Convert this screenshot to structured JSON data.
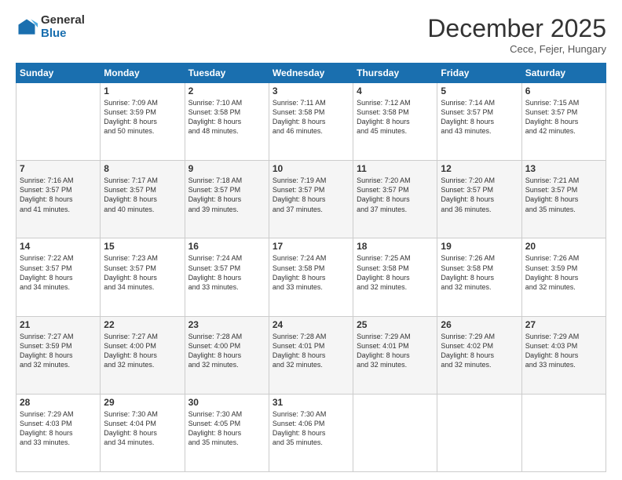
{
  "logo": {
    "general": "General",
    "blue": "Blue"
  },
  "header": {
    "month": "December 2025",
    "location": "Cece, Fejer, Hungary"
  },
  "weekdays": [
    "Sunday",
    "Monday",
    "Tuesday",
    "Wednesday",
    "Thursday",
    "Friday",
    "Saturday"
  ],
  "weeks": [
    [
      {
        "day": "",
        "info": ""
      },
      {
        "day": "1",
        "info": "Sunrise: 7:09 AM\nSunset: 3:59 PM\nDaylight: 8 hours\nand 50 minutes."
      },
      {
        "day": "2",
        "info": "Sunrise: 7:10 AM\nSunset: 3:58 PM\nDaylight: 8 hours\nand 48 minutes."
      },
      {
        "day": "3",
        "info": "Sunrise: 7:11 AM\nSunset: 3:58 PM\nDaylight: 8 hours\nand 46 minutes."
      },
      {
        "day": "4",
        "info": "Sunrise: 7:12 AM\nSunset: 3:58 PM\nDaylight: 8 hours\nand 45 minutes."
      },
      {
        "day": "5",
        "info": "Sunrise: 7:14 AM\nSunset: 3:57 PM\nDaylight: 8 hours\nand 43 minutes."
      },
      {
        "day": "6",
        "info": "Sunrise: 7:15 AM\nSunset: 3:57 PM\nDaylight: 8 hours\nand 42 minutes."
      }
    ],
    [
      {
        "day": "7",
        "info": "Sunrise: 7:16 AM\nSunset: 3:57 PM\nDaylight: 8 hours\nand 41 minutes."
      },
      {
        "day": "8",
        "info": "Sunrise: 7:17 AM\nSunset: 3:57 PM\nDaylight: 8 hours\nand 40 minutes."
      },
      {
        "day": "9",
        "info": "Sunrise: 7:18 AM\nSunset: 3:57 PM\nDaylight: 8 hours\nand 39 minutes."
      },
      {
        "day": "10",
        "info": "Sunrise: 7:19 AM\nSunset: 3:57 PM\nDaylight: 8 hours\nand 37 minutes."
      },
      {
        "day": "11",
        "info": "Sunrise: 7:20 AM\nSunset: 3:57 PM\nDaylight: 8 hours\nand 37 minutes."
      },
      {
        "day": "12",
        "info": "Sunrise: 7:20 AM\nSunset: 3:57 PM\nDaylight: 8 hours\nand 36 minutes."
      },
      {
        "day": "13",
        "info": "Sunrise: 7:21 AM\nSunset: 3:57 PM\nDaylight: 8 hours\nand 35 minutes."
      }
    ],
    [
      {
        "day": "14",
        "info": "Sunrise: 7:22 AM\nSunset: 3:57 PM\nDaylight: 8 hours\nand 34 minutes."
      },
      {
        "day": "15",
        "info": "Sunrise: 7:23 AM\nSunset: 3:57 PM\nDaylight: 8 hours\nand 34 minutes."
      },
      {
        "day": "16",
        "info": "Sunrise: 7:24 AM\nSunset: 3:57 PM\nDaylight: 8 hours\nand 33 minutes."
      },
      {
        "day": "17",
        "info": "Sunrise: 7:24 AM\nSunset: 3:58 PM\nDaylight: 8 hours\nand 33 minutes."
      },
      {
        "day": "18",
        "info": "Sunrise: 7:25 AM\nSunset: 3:58 PM\nDaylight: 8 hours\nand 32 minutes."
      },
      {
        "day": "19",
        "info": "Sunrise: 7:26 AM\nSunset: 3:58 PM\nDaylight: 8 hours\nand 32 minutes."
      },
      {
        "day": "20",
        "info": "Sunrise: 7:26 AM\nSunset: 3:59 PM\nDaylight: 8 hours\nand 32 minutes."
      }
    ],
    [
      {
        "day": "21",
        "info": "Sunrise: 7:27 AM\nSunset: 3:59 PM\nDaylight: 8 hours\nand 32 minutes."
      },
      {
        "day": "22",
        "info": "Sunrise: 7:27 AM\nSunset: 4:00 PM\nDaylight: 8 hours\nand 32 minutes."
      },
      {
        "day": "23",
        "info": "Sunrise: 7:28 AM\nSunset: 4:00 PM\nDaylight: 8 hours\nand 32 minutes."
      },
      {
        "day": "24",
        "info": "Sunrise: 7:28 AM\nSunset: 4:01 PM\nDaylight: 8 hours\nand 32 minutes."
      },
      {
        "day": "25",
        "info": "Sunrise: 7:29 AM\nSunset: 4:01 PM\nDaylight: 8 hours\nand 32 minutes."
      },
      {
        "day": "26",
        "info": "Sunrise: 7:29 AM\nSunset: 4:02 PM\nDaylight: 8 hours\nand 32 minutes."
      },
      {
        "day": "27",
        "info": "Sunrise: 7:29 AM\nSunset: 4:03 PM\nDaylight: 8 hours\nand 33 minutes."
      }
    ],
    [
      {
        "day": "28",
        "info": "Sunrise: 7:29 AM\nSunset: 4:03 PM\nDaylight: 8 hours\nand 33 minutes."
      },
      {
        "day": "29",
        "info": "Sunrise: 7:30 AM\nSunset: 4:04 PM\nDaylight: 8 hours\nand 34 minutes."
      },
      {
        "day": "30",
        "info": "Sunrise: 7:30 AM\nSunset: 4:05 PM\nDaylight: 8 hours\nand 35 minutes."
      },
      {
        "day": "31",
        "info": "Sunrise: 7:30 AM\nSunset: 4:06 PM\nDaylight: 8 hours\nand 35 minutes."
      },
      {
        "day": "",
        "info": ""
      },
      {
        "day": "",
        "info": ""
      },
      {
        "day": "",
        "info": ""
      }
    ]
  ]
}
